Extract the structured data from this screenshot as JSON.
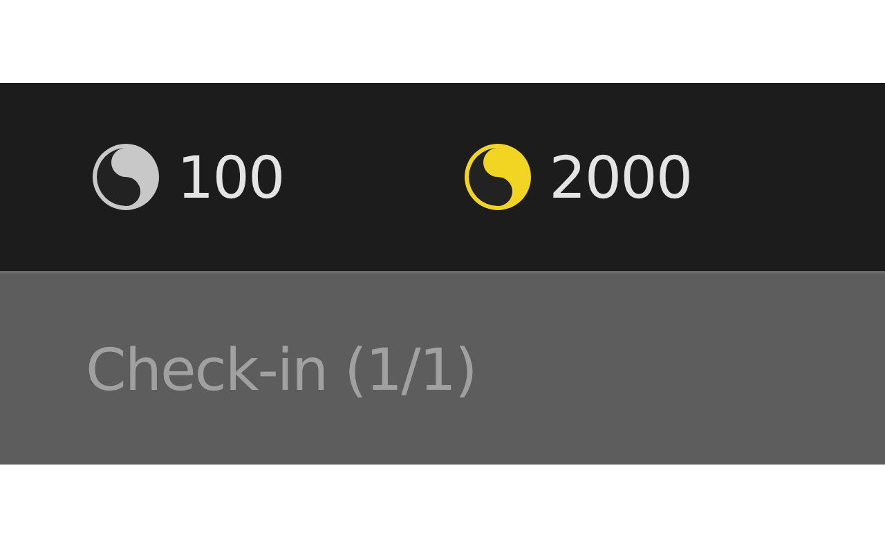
{
  "currencies": [
    {
      "amount": "100",
      "color": "#c8c8c8"
    },
    {
      "amount": "2000",
      "color": "#f2d423"
    }
  ],
  "checkin": {
    "label": "Check-in (1/1)"
  }
}
